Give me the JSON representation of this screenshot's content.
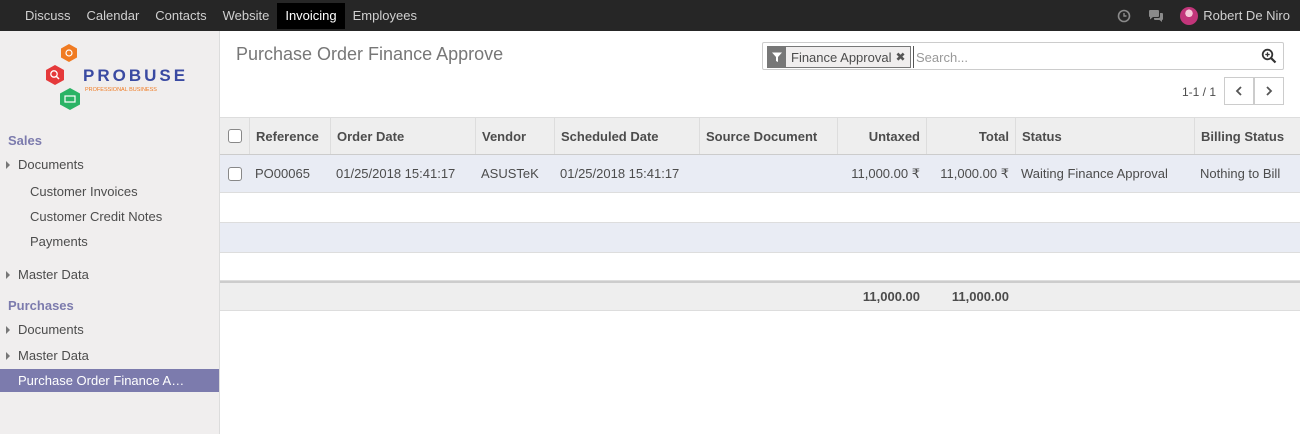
{
  "topbar": {
    "apps": [
      "Discuss",
      "Calendar",
      "Contacts",
      "Website",
      "Invoicing",
      "Employees"
    ],
    "active_app": "Invoicing",
    "user_name": "Robert De Niro",
    "icons": [
      "clock-icon",
      "chat-icon"
    ]
  },
  "logo": {
    "brand": "PROBUSE",
    "tagline": "PROFESSIONAL BUSINESS",
    "colors": {
      "orange": "#f07b22",
      "red": "#e5393a",
      "green": "#2ab365",
      "text": "#3a4aa2"
    }
  },
  "sidebar": {
    "sales_title": "Sales",
    "sales_documents": "Documents",
    "customer_invoices": "Customer Invoices",
    "customer_credit_notes": "Customer Credit Notes",
    "payments": "Payments",
    "sales_master_data": "Master Data",
    "purchases_title": "Purchases",
    "purchases_documents": "Documents",
    "purchases_master_data": "Master Data",
    "po_finance_approve": "Purchase Order Finance A…"
  },
  "control_panel": {
    "title": "Purchase Order Finance Approve",
    "facet_label": "Finance Approval",
    "facet_close": "✖",
    "search_placeholder": "Search...",
    "pager": "1-1 / 1"
  },
  "table": {
    "headers": {
      "reference": "Reference",
      "order_date": "Order Date",
      "vendor": "Vendor",
      "scheduled_date": "Scheduled Date",
      "source_document": "Source Document",
      "untaxed": "Untaxed",
      "total": "Total",
      "status": "Status",
      "billing_status": "Billing Status"
    },
    "rows": [
      {
        "reference": "PO00065",
        "order_date": "01/25/2018 15:41:17",
        "vendor": "ASUSTeK",
        "scheduled_date": "01/25/2018 15:41:17",
        "source_document": "",
        "untaxed": "11,000.00 ₹",
        "total": "11,000.00 ₹",
        "status": "Waiting Finance Approval",
        "billing_status": "Nothing to Bill"
      }
    ],
    "footer": {
      "untaxed": "11,000.00",
      "total": "11,000.00"
    }
  },
  "colors": {
    "topbar": "#262626",
    "sidebar_active": "#7c7bad",
    "row_stripe": "#e9ecf4"
  }
}
